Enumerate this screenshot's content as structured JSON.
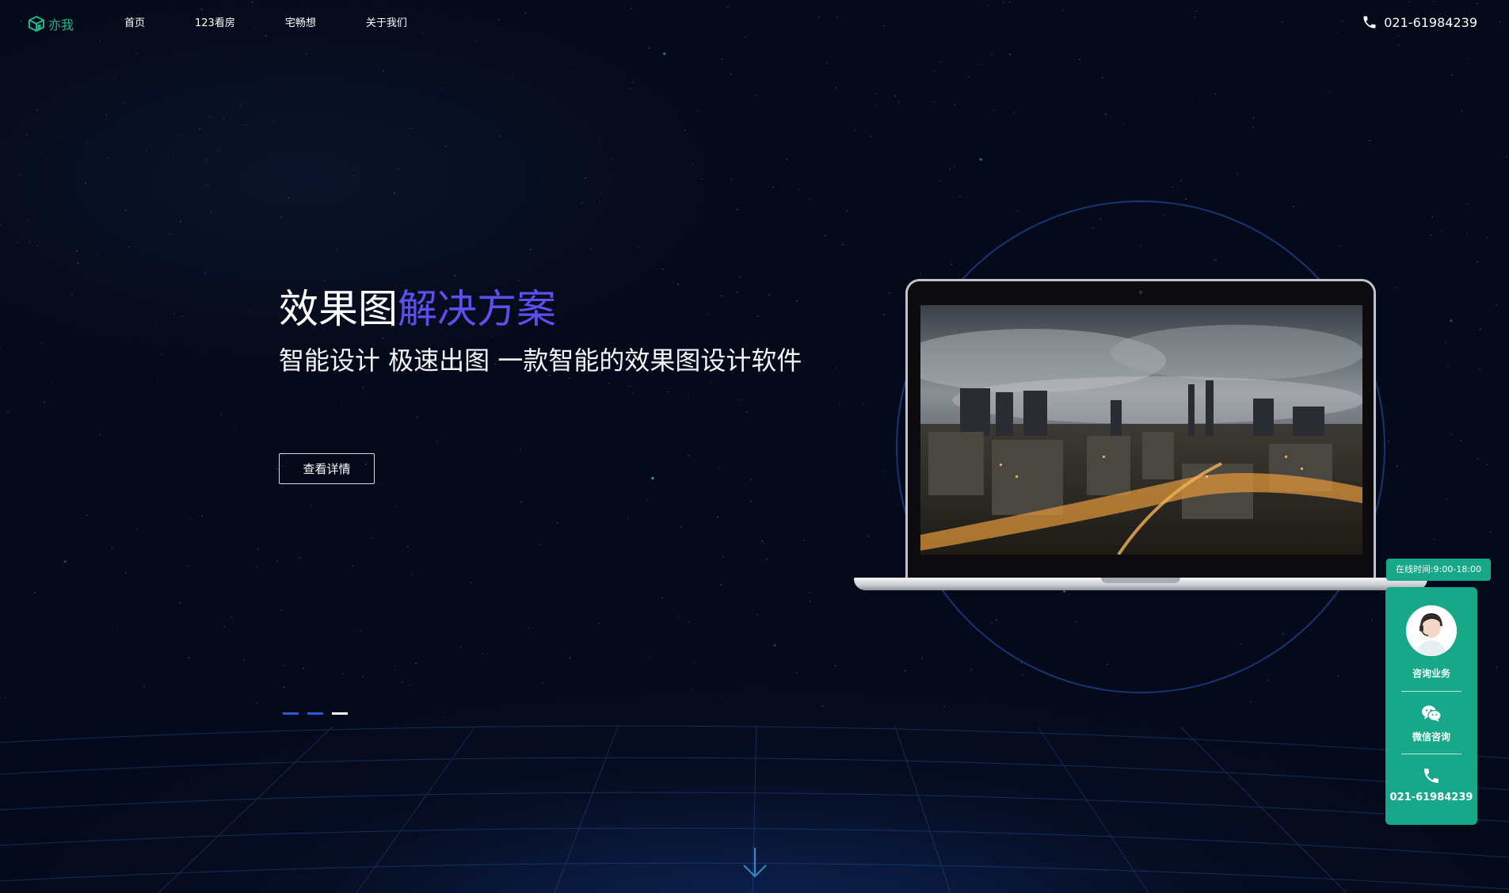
{
  "nav": {
    "brand": "亦我",
    "items": [
      "首页",
      "123看房",
      "宅畅想",
      "关于我们"
    ],
    "phone": "021-61984239"
  },
  "hero": {
    "title_main": "效果图",
    "title_highlight": "解决方案",
    "subtitle": "智能设计 极速出图 一款智能的效果图设计软件",
    "button_label": "查看详情",
    "slides": {
      "count": 3,
      "active_index": 2
    }
  },
  "service": {
    "hours": "在线时间:9:00-18:00",
    "consult_label": "咨询业务",
    "wechat_label": "微信咨询",
    "phone": "021-61984239"
  },
  "icons": {
    "logo": "cube-logo-icon",
    "phone": "phone-icon",
    "avatar": "customer-service-avatar",
    "wechat": "wechat-icon",
    "scroll": "chevron-down-arrow-icon"
  },
  "colors": {
    "background": "#050a1a",
    "brand_green": "#1db88a",
    "title_highlight": "#5b4ff0",
    "service_green": "#16a889",
    "active_dot": "#ffffff",
    "inactive_dot": "#2a5bd7"
  }
}
